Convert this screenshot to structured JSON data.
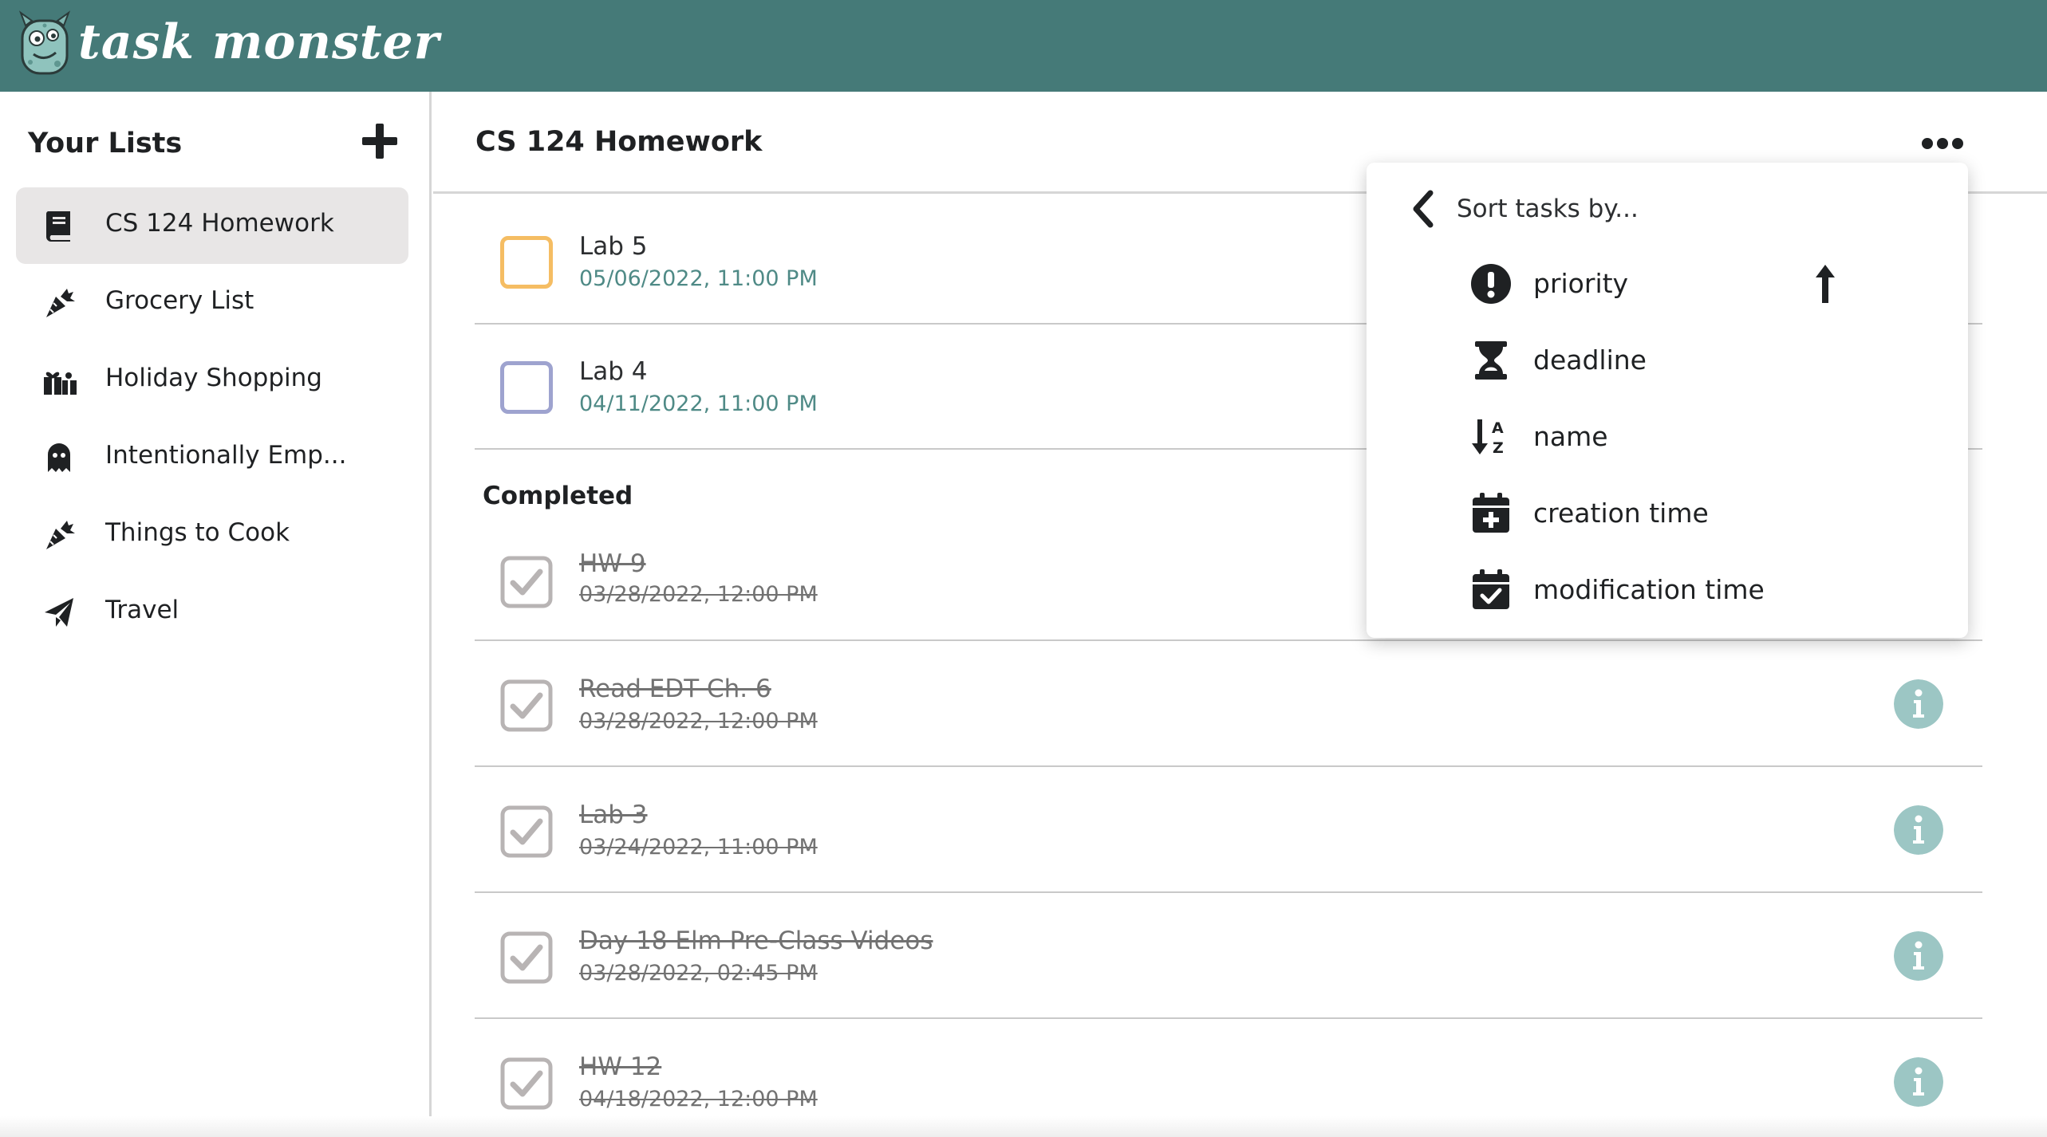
{
  "app": {
    "name": "task monster",
    "header_color": "#457a78",
    "accent_teal": "#4f8a86"
  },
  "sidebar": {
    "title": "Your Lists",
    "add_icon": "plus-icon",
    "items": [
      {
        "label": "CS 124 Homework",
        "icon": "book-icon",
        "active": true
      },
      {
        "label": "Grocery List",
        "icon": "carrot-icon",
        "active": false
      },
      {
        "label": "Holiday Shopping",
        "icon": "gifts-icon",
        "active": false
      },
      {
        "label": "Intentionally Emp...",
        "icon": "ghost-icon",
        "active": false
      },
      {
        "label": "Things to Cook",
        "icon": "carrot-icon",
        "active": false
      },
      {
        "label": "Travel",
        "icon": "paper-plane-icon",
        "active": false
      }
    ]
  },
  "main": {
    "title": "CS 124 Homework",
    "more_icon": "ellipsis-icon",
    "open_tasks": [
      {
        "name": "Lab 5",
        "date": "05/06/2022, 11:00 PM",
        "checkbox_color": "#f5bd63"
      },
      {
        "name": "Lab 4",
        "date": "04/11/2022, 11:00 PM",
        "checkbox_color": "#9ea3cf"
      }
    ],
    "completed_heading": "Completed",
    "completed_tasks": [
      {
        "name": "HW 9",
        "date": "03/28/2022, 12:00 PM"
      },
      {
        "name": "Read EDT Ch. 6",
        "date": "03/28/2022, 12:00 PM"
      },
      {
        "name": "Lab 3",
        "date": "03/24/2022, 11:00 PM"
      },
      {
        "name": "Day 18 Elm Pre-Class Videos",
        "date": "03/28/2022, 02:45 PM"
      },
      {
        "name": "HW 12",
        "date": "04/18/2022, 12:00 PM"
      }
    ]
  },
  "sort_menu": {
    "title": "Sort tasks by...",
    "back_icon": "chevron-left-icon",
    "options": [
      {
        "label": "priority",
        "icon": "exclamation-circle-icon",
        "selected": true,
        "direction_icon": "arrow-up-icon"
      },
      {
        "label": "deadline",
        "icon": "hourglass-icon",
        "selected": false
      },
      {
        "label": "name",
        "icon": "sort-alpha-down-icon",
        "selected": false
      },
      {
        "label": "creation time",
        "icon": "calendar-plus-icon",
        "selected": false
      },
      {
        "label": "modification time",
        "icon": "calendar-check-icon",
        "selected": false
      }
    ]
  }
}
